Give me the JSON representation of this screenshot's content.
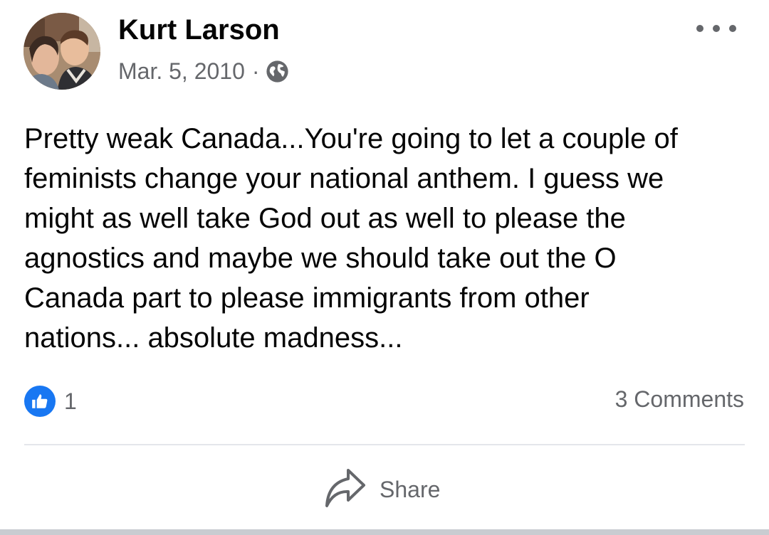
{
  "post": {
    "author": "Kurt Larson",
    "date": "Mar. 5, 2010",
    "separator": "·",
    "privacy_icon": "globe-icon",
    "menu_icon": "more-options-icon",
    "text": "Pretty weak Canada...You're going to let a couple of\nfeminists change your national anthem. I guess we\nmight as well take God out as well to please the\nagnostics and maybe we should take out the O\nCanada part to please immigrants from other\nnations... absolute madness...",
    "reactions": {
      "icon": "thumbs-up-icon",
      "count": "1"
    },
    "comments_label": "3 Comments",
    "share": {
      "icon": "share-arrow-icon",
      "label": "Share"
    }
  },
  "colors": {
    "accent": "#1877f2",
    "secondary_text": "#65676b",
    "primary_text": "#050505",
    "divider": "#e4e6eb"
  }
}
